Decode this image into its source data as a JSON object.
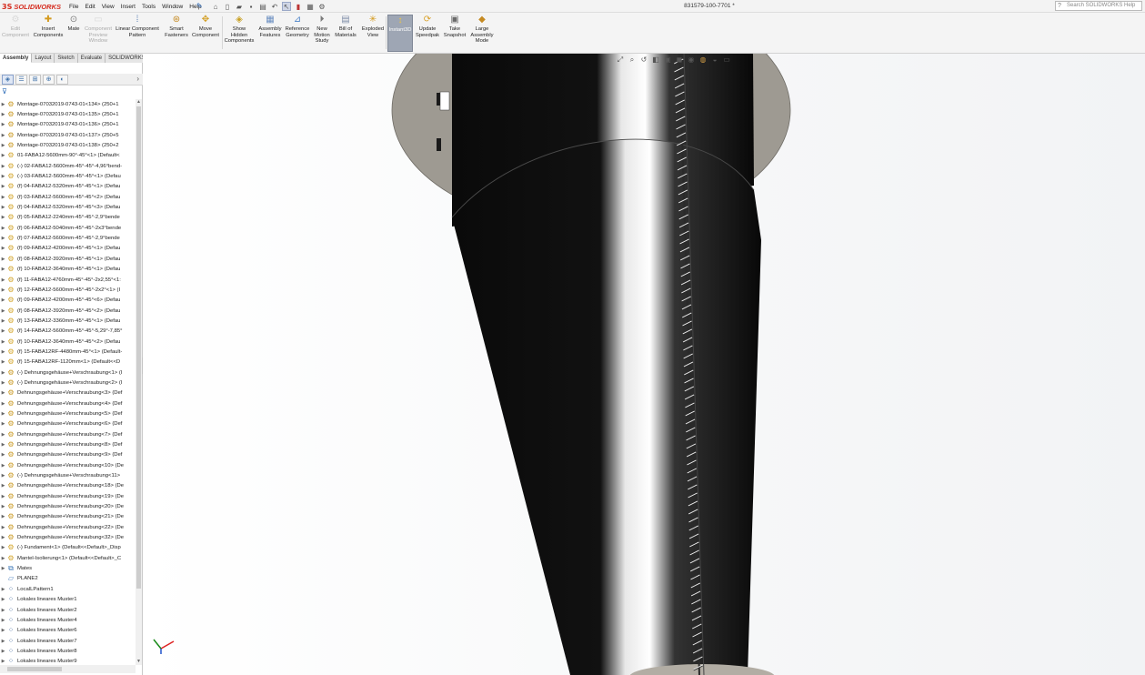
{
  "app": {
    "logo_mark": "3S",
    "logo_text": "SOLIDWORKS",
    "document_title": "831579-100-7701 *",
    "help_search_placeholder": "Search SOLIDWORKS Help"
  },
  "menu": [
    "File",
    "Edit",
    "View",
    "Insert",
    "Tools",
    "Window",
    "Help"
  ],
  "commands": [
    {
      "label": "Edit\nComponent",
      "enabled": false,
      "icon": "edit-component-icon"
    },
    {
      "label": "Insert\nComponents",
      "enabled": true,
      "icon": "insert-components-icon"
    },
    {
      "label": "Mate",
      "enabled": true,
      "icon": "mate-icon"
    },
    {
      "label": "Component\nPreview\nWindow",
      "enabled": false,
      "icon": "component-preview-icon"
    },
    {
      "label": "Linear Component\nPattern",
      "enabled": true,
      "icon": "linear-pattern-icon"
    },
    {
      "label": "Smart\nFasteners",
      "enabled": true,
      "icon": "smart-fasteners-icon"
    },
    {
      "label": "Move\nComponent",
      "enabled": true,
      "icon": "move-component-icon"
    },
    {
      "label": "Show\nHidden\nComponents",
      "enabled": true,
      "icon": "show-hidden-icon"
    },
    {
      "label": "Assembly\nFeatures",
      "enabled": true,
      "icon": "assembly-features-icon"
    },
    {
      "label": "Reference\nGeometry",
      "enabled": true,
      "icon": "reference-geometry-icon"
    },
    {
      "label": "New\nMotion\nStudy",
      "enabled": true,
      "icon": "motion-study-icon"
    },
    {
      "label": "Bill of\nMaterials",
      "enabled": true,
      "icon": "bom-icon"
    },
    {
      "label": "Exploded\nView",
      "enabled": true,
      "icon": "exploded-view-icon"
    },
    {
      "label": "Instant3D",
      "enabled": true,
      "active": true,
      "icon": "instant3d-icon"
    },
    {
      "label": "Update\nSpeedpak",
      "enabled": true,
      "icon": "speedpak-icon"
    },
    {
      "label": "Take\nSnapshot",
      "enabled": true,
      "icon": "snapshot-icon"
    },
    {
      "label": "Large\nAssembly\nMode",
      "enabled": true,
      "icon": "large-assembly-icon"
    }
  ],
  "tabs": [
    "Assembly",
    "Layout",
    "Sketch",
    "Evaluate",
    "SOLIDWORKS Add-Ins"
  ],
  "active_tab": "Assembly",
  "tree": [
    {
      "text": "Montage-07032019-0743-01<134> (250+1",
      "icon": "asm"
    },
    {
      "text": "Montage-07032019-0743-01<135> (250+1",
      "icon": "asm"
    },
    {
      "text": "Montage-07032019-0743-01<136> (250+1",
      "icon": "asm"
    },
    {
      "text": "Montage-07032019-0743-01<137> (250+5",
      "icon": "asm"
    },
    {
      "text": "Montage-07032019-0743-01<138> (250+2",
      "icon": "asm"
    },
    {
      "text": "01-FABA12-5600mm-90°-45°<1> (Default<",
      "icon": "part"
    },
    {
      "text": "(-) 02-FABA12-5600mm-45°-45°-4,96°bend-",
      "icon": "part"
    },
    {
      "text": "(-) 03-FABA12-5600mm-45°-45°<1> (Defau",
      "icon": "part"
    },
    {
      "text": "(f) 04-FABA12-5320mm-45°-45°<1> (Defau",
      "icon": "part"
    },
    {
      "text": "(f) 03-FABA12-5600mm-45°-45°<2> (Defau",
      "icon": "part"
    },
    {
      "text": "(f) 04-FABA12-5320mm-45°-45°<3> (Defau",
      "icon": "part"
    },
    {
      "text": "(f) 05-FABA12-2240mm-45°-45°-2,9°bende",
      "icon": "part"
    },
    {
      "text": "(f) 06-FABA12-5040mm-45°-45°-2x3°bende",
      "icon": "part"
    },
    {
      "text": "(f) 07-FABA12-5600mm-45°-45°-2,9°bende",
      "icon": "part"
    },
    {
      "text": "(f) 09-FABA12-4200mm-45°-45°<1> (Defau",
      "icon": "part"
    },
    {
      "text": "(f) 08-FABA12-3920mm-45°-45°<1> (Defau",
      "icon": "part"
    },
    {
      "text": "(f) 10-FABA12-3640mm-45°-45°<1> (Defau",
      "icon": "part"
    },
    {
      "text": "(f) 11-FABA12-4760mm-45°-45°-2x2,55°<1:",
      "icon": "part"
    },
    {
      "text": "(f) 12-FABA12-5600mm-45°-45°-2x2°<1> (I",
      "icon": "part"
    },
    {
      "text": "(f) 09-FABA12-4200mm-45°-45°<6> (Defau",
      "icon": "part"
    },
    {
      "text": "(f) 08-FABA12-3920mm-45°-45°<2> (Defau",
      "icon": "part"
    },
    {
      "text": "(f) 13-FABA12-3360mm-45°-45°<1> (Defau",
      "icon": "part"
    },
    {
      "text": "(f) 14-FABA12-5600mm-45°-45°-5,29°-7,85°",
      "icon": "part"
    },
    {
      "text": "(f) 10-FABA12-3640mm-45°-45°<2> (Defau",
      "icon": "part"
    },
    {
      "text": "(f) 15-FABA12RF-4480mm-45°<1> (Default-",
      "icon": "part"
    },
    {
      "text": "(f) 15-FABA12RF-1120mm<1> (Default<<D",
      "icon": "part"
    },
    {
      "text": "(-) Dehnungsgehäuse+Verschraubung<1> (I",
      "icon": "asm"
    },
    {
      "text": "(-) Dehnungsgehäuse+Verschraubung<2> (I",
      "icon": "asm"
    },
    {
      "text": "Dehnungsgehäuse+Verschraubung<3> (Def",
      "icon": "asm"
    },
    {
      "text": "Dehnungsgehäuse+Verschraubung<4> (Def",
      "icon": "asm"
    },
    {
      "text": "Dehnungsgehäuse+Verschraubung<5> (Def",
      "icon": "asm"
    },
    {
      "text": "Dehnungsgehäuse+Verschraubung<6> (Def",
      "icon": "asm"
    },
    {
      "text": "Dehnungsgehäuse+Verschraubung<7> (Def",
      "icon": "asm"
    },
    {
      "text": "Dehnungsgehäuse+Verschraubung<8> (Def",
      "icon": "asm"
    },
    {
      "text": "Dehnungsgehäuse+Verschraubung<9> (Def",
      "icon": "asm"
    },
    {
      "text": "Dehnungsgehäuse+Verschraubung<10> (De",
      "icon": "asm"
    },
    {
      "text": "(-) Dehnungsgehäuse+Verschraubung<11>",
      "icon": "asm"
    },
    {
      "text": "Dehnungsgehäuse+Verschraubung<18> (De",
      "icon": "asm"
    },
    {
      "text": "Dehnungsgehäuse+Verschraubung<19> (De",
      "icon": "asm"
    },
    {
      "text": "Dehnungsgehäuse+Verschraubung<20> (De",
      "icon": "asm"
    },
    {
      "text": "Dehnungsgehäuse+Verschraubung<21> (De",
      "icon": "asm"
    },
    {
      "text": "Dehnungsgehäuse+Verschraubung<22> (De",
      "icon": "asm"
    },
    {
      "text": "Dehnungsgehäuse+Verschraubung<32> (De",
      "icon": "asm"
    },
    {
      "text": "(-) Fundament<1> (Default<<Default>_Disp",
      "icon": "part"
    },
    {
      "text": "Mantel-Isolierung<1> (Default<<Default>_C",
      "icon": "part"
    },
    {
      "text": "Mates",
      "icon": "folder"
    },
    {
      "text": "PLANE2",
      "icon": "plane"
    },
    {
      "text": "LocalLPattern1",
      "icon": "pat"
    },
    {
      "text": "Lokales lineares Muster1",
      "icon": "pat"
    },
    {
      "text": "Lokales lineares Muster2",
      "icon": "pat"
    },
    {
      "text": "Lokales lineares Muster4",
      "icon": "pat"
    },
    {
      "text": "Lokales lineares Muster6",
      "icon": "pat"
    },
    {
      "text": "Lokales lineares Muster7",
      "icon": "pat"
    },
    {
      "text": "Lokales lineares Muster8",
      "icon": "pat"
    },
    {
      "text": "Lokales lineares Muster9",
      "icon": "pat"
    }
  ],
  "colors": {
    "brand_red": "#d52b1e",
    "tower_black": "#0c0c0c",
    "flange_gray": "#9e9a92",
    "active_button": "#9ea6b4"
  }
}
